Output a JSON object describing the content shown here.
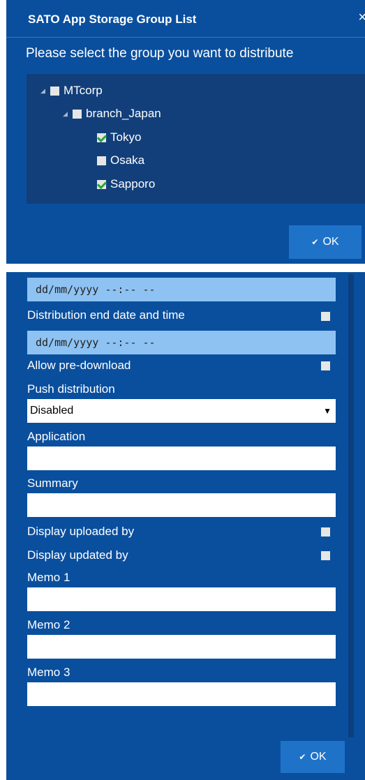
{
  "dialog": {
    "title": "SATO App Storage Group List",
    "close": "×",
    "prompt": "Please select the group you want to distribute",
    "ok_label": "OK",
    "tree": [
      {
        "label": "MTcorp",
        "checked": false
      },
      {
        "label": "branch_Japan",
        "checked": false
      },
      {
        "label": "Tokyo",
        "checked": true
      },
      {
        "label": "Osaka",
        "checked": false
      },
      {
        "label": "Sapporo",
        "checked": true
      }
    ]
  },
  "form": {
    "start_date_placeholder": "dd/mm/yyyy --:-- --",
    "end_date_label": "Distribution end date and time",
    "end_date_placeholder": "dd/mm/yyyy --:-- --",
    "pre_download_label": "Allow pre-download",
    "push_label": "Push distribution",
    "push_value": "Disabled",
    "application_label": "Application",
    "summary_label": "Summary",
    "uploaded_by_label": "Display uploaded by",
    "updated_by_label": "Display updated by",
    "memo1_label": "Memo 1",
    "memo2_label": "Memo 2",
    "memo3_label": "Memo 3",
    "ok_label": "OK"
  },
  "colors": {
    "panel": "#0a4f9e",
    "tree_bg": "#123f7a",
    "button": "#1e73c9",
    "date_input": "#8ec2f2",
    "check": "#27a639"
  }
}
